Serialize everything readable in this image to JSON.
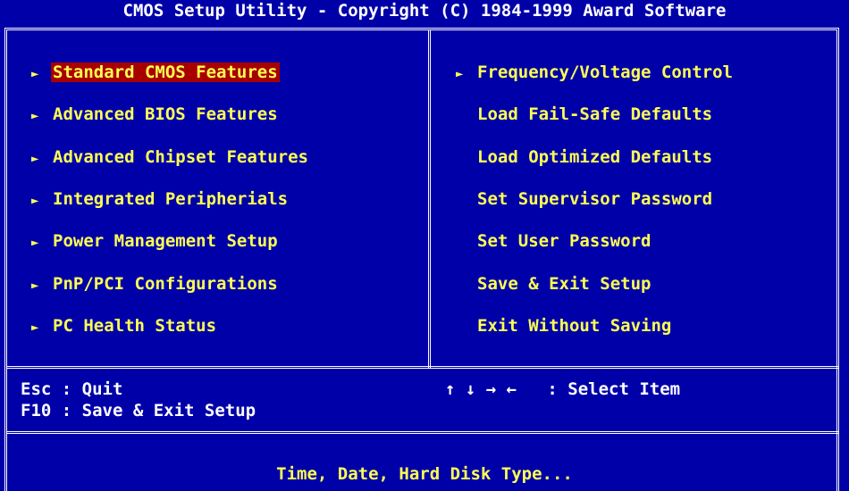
{
  "title": "CMOS Setup Utility - Copyright (C) 1984-1999 Award Software",
  "left_menu": [
    {
      "label": "Standard CMOS Features",
      "arrow": "►",
      "selected": true
    },
    {
      "label": "Advanced BIOS Features",
      "arrow": "►"
    },
    {
      "label": "Advanced Chipset Features",
      "arrow": "►"
    },
    {
      "label": "Integrated Peripherials",
      "arrow": "►"
    },
    {
      "label": "Power Management Setup",
      "arrow": "►"
    },
    {
      "label": "PnP/PCI Configurations",
      "arrow": "►"
    },
    {
      "label": "PC Health Status",
      "arrow": "►"
    }
  ],
  "right_menu": [
    {
      "label": "Frequency/Voltage Control",
      "arrow": "►"
    },
    {
      "label": "Load Fail-Safe Defaults"
    },
    {
      "label": "Load Optimized Defaults"
    },
    {
      "label": "Set Supervisor Password"
    },
    {
      "label": "Set User Password"
    },
    {
      "label": "Save & Exit Setup"
    },
    {
      "label": "Exit Without Saving"
    }
  ],
  "help": {
    "esc": "Esc : Quit",
    "f10": "F10 : Save & Exit Setup",
    "arrows": "↑ ↓ → ←   : Select Item"
  },
  "status": "Time, Date, Hard Disk Type...",
  "colors": {
    "background": "#0000a8",
    "text_yellow": "#ffff54",
    "text_white": "#ffffff",
    "highlight": "#a80000"
  }
}
